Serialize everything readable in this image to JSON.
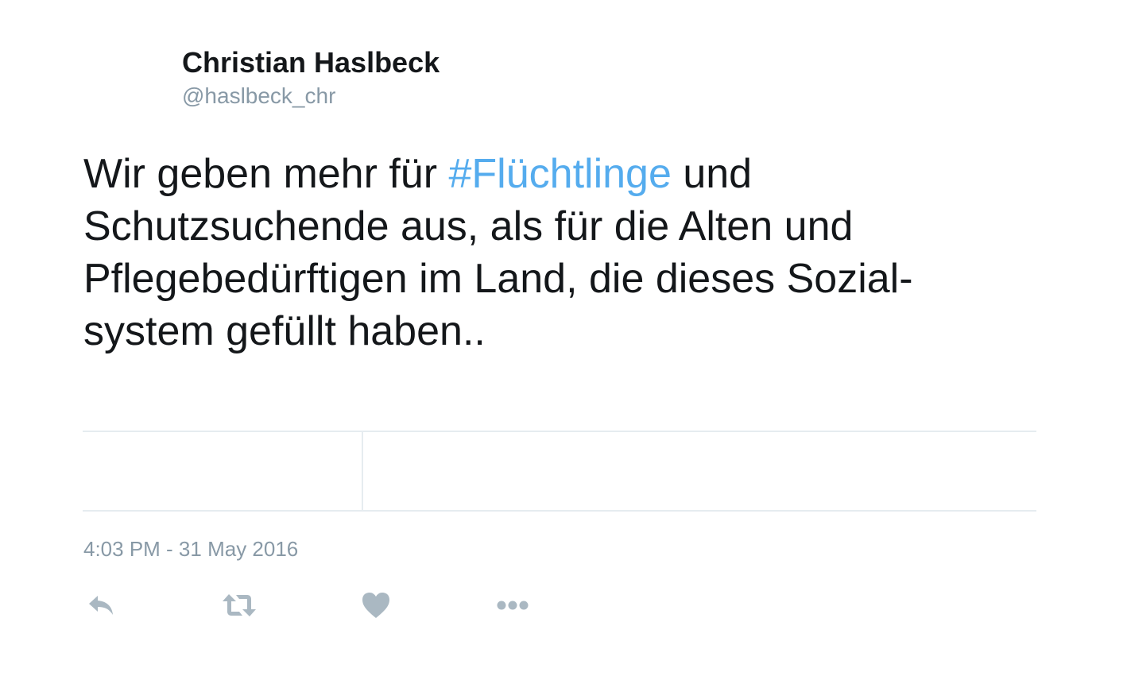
{
  "tweet": {
    "author": {
      "display_name": "Christian Haslbeck",
      "handle": "@haslbeck_chr"
    },
    "text": {
      "line1_before": "Wir geben mehr für ",
      "hashtag": "#Flüchtlinge",
      "line1_after": " und",
      "line2": "Schutzsuchende aus, als für die Alten und",
      "line3": "Pflegebedürftigen im Land, die dieses Sozial-",
      "line4": "system gefüllt haben.."
    },
    "timestamp": "4:03 PM - 31 May 2016",
    "actions": [
      {
        "name": "reply",
        "icon": "reply-icon"
      },
      {
        "name": "retweet",
        "icon": "retweet-icon"
      },
      {
        "name": "like",
        "icon": "heart-icon"
      },
      {
        "name": "more",
        "icon": "more-dots-icon"
      }
    ]
  },
  "colors": {
    "text": "#14171a",
    "muted": "#8899a6",
    "hashtag": "#55acee",
    "divider": "#e6ecf0",
    "icon": "#aab8c2"
  }
}
